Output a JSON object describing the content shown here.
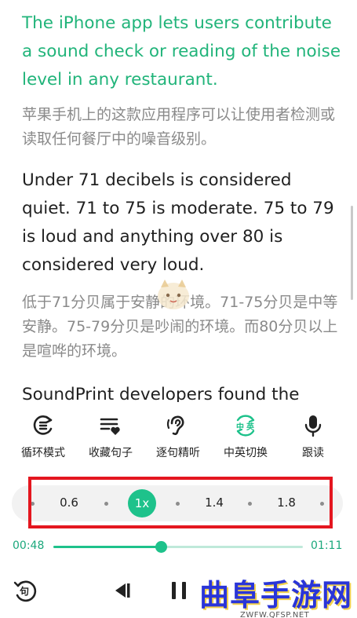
{
  "content": {
    "en_1": "The iPhone app lets users contribute a sound check or reading of the noise level in any restaurant.",
    "zh_1": "苹果手机上的这款应用程序可以让使用者检测或读取任何餐厅中的噪音级别。",
    "en_2": "Under 71 decibels is considered quiet. 71 to 75 is moderate. 75 to 79 is loud and anything over 80 is considered very loud.",
    "zh_2": "低于71分贝属于安静的环境。71-75分贝是中等安静。75-79分贝是吵闹的环境。而80分贝以上是喧哗的环境。",
    "en_3": "SoundPrint developers found the"
  },
  "toolbar": {
    "items": [
      {
        "label": "循环模式",
        "icon": "loop-mode-icon"
      },
      {
        "label": "收藏句子",
        "icon": "favorite-sentence-icon"
      },
      {
        "label": "逐句精听",
        "icon": "listen-sentence-icon"
      },
      {
        "label": "中英切换",
        "icon": "language-switch-icon",
        "icon_text_zh": "中",
        "icon_text_en": "英"
      },
      {
        "label": "跟读",
        "icon": "microphone-icon"
      }
    ]
  },
  "speed": {
    "options": [
      "0.6",
      "1x",
      "1.4",
      "1.8"
    ],
    "selected": "1x"
  },
  "player": {
    "current_time": "00:48",
    "total_time": "01:11",
    "progress": 0.43
  },
  "brand": {
    "title": "曲阜手游网",
    "url": "ZWFW.QFSP.NET"
  },
  "colors": {
    "accent": "#1ec28b",
    "highlight_border": "#e4161f"
  }
}
